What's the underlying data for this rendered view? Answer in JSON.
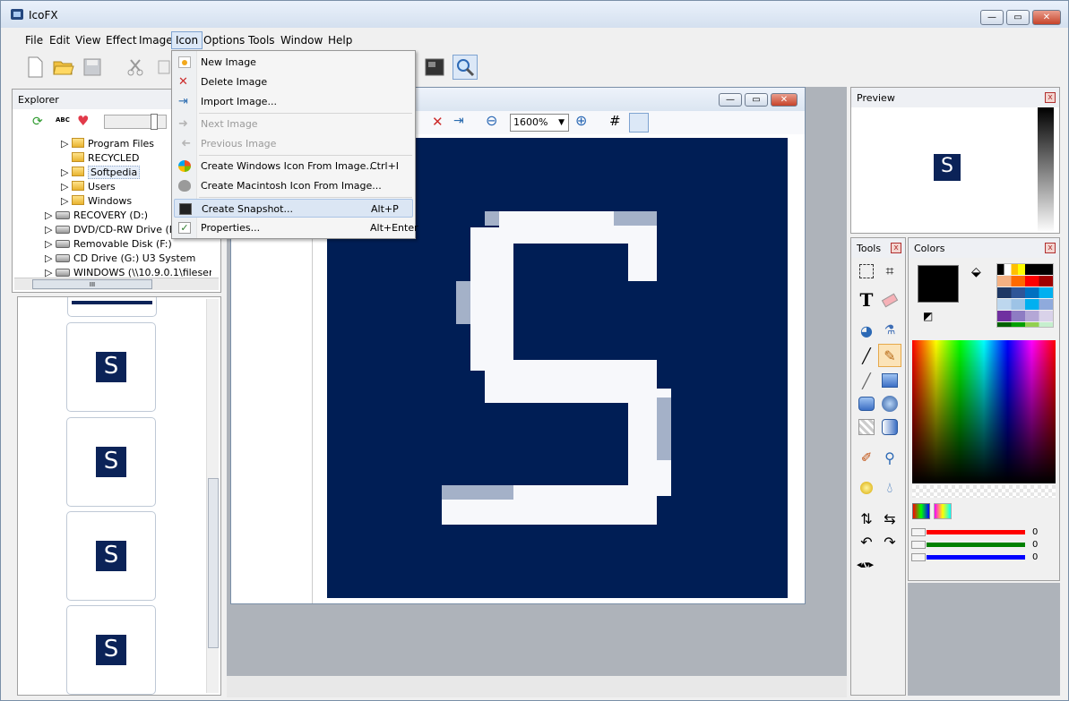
{
  "app": {
    "title": "IcoFX"
  },
  "window_controls": {
    "minimize": "—",
    "maximize": "▭",
    "close": "✕"
  },
  "menubar": [
    "File",
    "Edit",
    "View",
    "Effect",
    "Image",
    "Icon",
    "Options",
    "Tools",
    "Window",
    "Help"
  ],
  "explorer": {
    "title": "Explorer",
    "tree": [
      "Program Files",
      "RECYCLED",
      "Softpedia",
      "Users",
      "Windows",
      "RECOVERY (D:)",
      "DVD/CD-RW Drive (E:)",
      "Removable Disk (F:)",
      "CD Drive (G:) U3 System",
      "WINDOWS (\\\\10.9.0.1\\fileser"
    ],
    "scroll_glyph": "III"
  },
  "thumbnail_logo": "S",
  "editor": {
    "zoom": "1600%",
    "canvas_letter": "S"
  },
  "icon_menu": [
    {
      "label": "New Image",
      "shortcut": "",
      "disabled": false,
      "highlight": false
    },
    {
      "label": "Delete Image",
      "shortcut": "",
      "disabled": false,
      "highlight": false
    },
    {
      "label": "Import Image...",
      "shortcut": "",
      "disabled": false,
      "highlight": false
    },
    {
      "label": "Next Image",
      "shortcut": "",
      "disabled": true,
      "highlight": false
    },
    {
      "label": "Previous Image",
      "shortcut": "",
      "disabled": true,
      "highlight": false
    },
    {
      "label": "Create Windows Icon From Image...",
      "shortcut": "Ctrl+I",
      "disabled": false,
      "highlight": false
    },
    {
      "label": "Create Macintosh Icon From Image...",
      "shortcut": "",
      "disabled": false,
      "highlight": false
    },
    {
      "label": "Create Snapshot...",
      "shortcut": "Alt+P",
      "disabled": false,
      "highlight": true
    },
    {
      "label": "Properties...",
      "shortcut": "Alt+Enter",
      "disabled": false,
      "highlight": false
    }
  ],
  "preview": {
    "title": "Preview",
    "logo": "S"
  },
  "tools": {
    "title": "Tools"
  },
  "colors": {
    "title": "Colors",
    "channels": [
      {
        "name": "red",
        "value": "0",
        "color": "#ff0000"
      },
      {
        "name": "green",
        "value": "0",
        "color": "#008000"
      },
      {
        "name": "blue",
        "value": "0",
        "color": "#0000ff"
      }
    ],
    "current": "#000000"
  },
  "panel_close": "x"
}
